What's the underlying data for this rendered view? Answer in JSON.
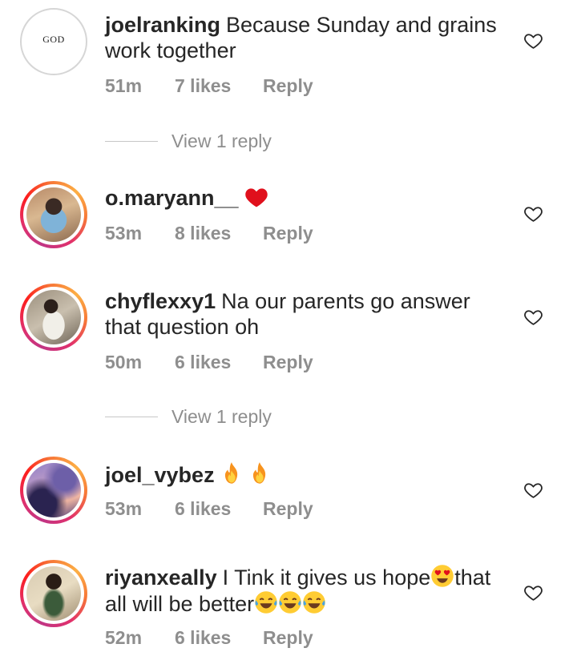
{
  "comments": [
    {
      "username": "joelranking",
      "text": "Because Sunday and grains work together",
      "time": "51m",
      "likes": "7 likes",
      "reply": "Reply",
      "avatar_text": "GOD"
    },
    {
      "username": "o.maryann__",
      "text": "",
      "time": "53m",
      "likes": "8 likes",
      "reply": "Reply"
    },
    {
      "username": "chyflexxy1",
      "text": "Na our parents go answer that question oh",
      "time": "50m",
      "likes": "6 likes",
      "reply": "Reply"
    },
    {
      "username": "joel_vybez",
      "text": "",
      "time": "53m",
      "likes": "6 likes",
      "reply": "Reply"
    },
    {
      "username": "riyanxeally",
      "text_part1": "I Tink it gives us hope",
      "text_part2": "that all will be better",
      "time": "52m",
      "likes": "6 likes",
      "reply": "Reply"
    }
  ],
  "view_replies": [
    {
      "label": "View 1 reply"
    },
    {
      "label": "View 1 reply"
    }
  ],
  "icons": {
    "like": "heart-outline-icon",
    "red_heart": "red-heart-emoji",
    "fire": "fire-emoji",
    "heart_eyes": "heart-eyes-emoji",
    "tears_of_joy": "tears-of-joy-emoji"
  },
  "colors": {
    "meta": "#8e8e8e",
    "text": "#262626",
    "ring_start": "#c13584",
    "ring_end": "#fcaf45"
  }
}
